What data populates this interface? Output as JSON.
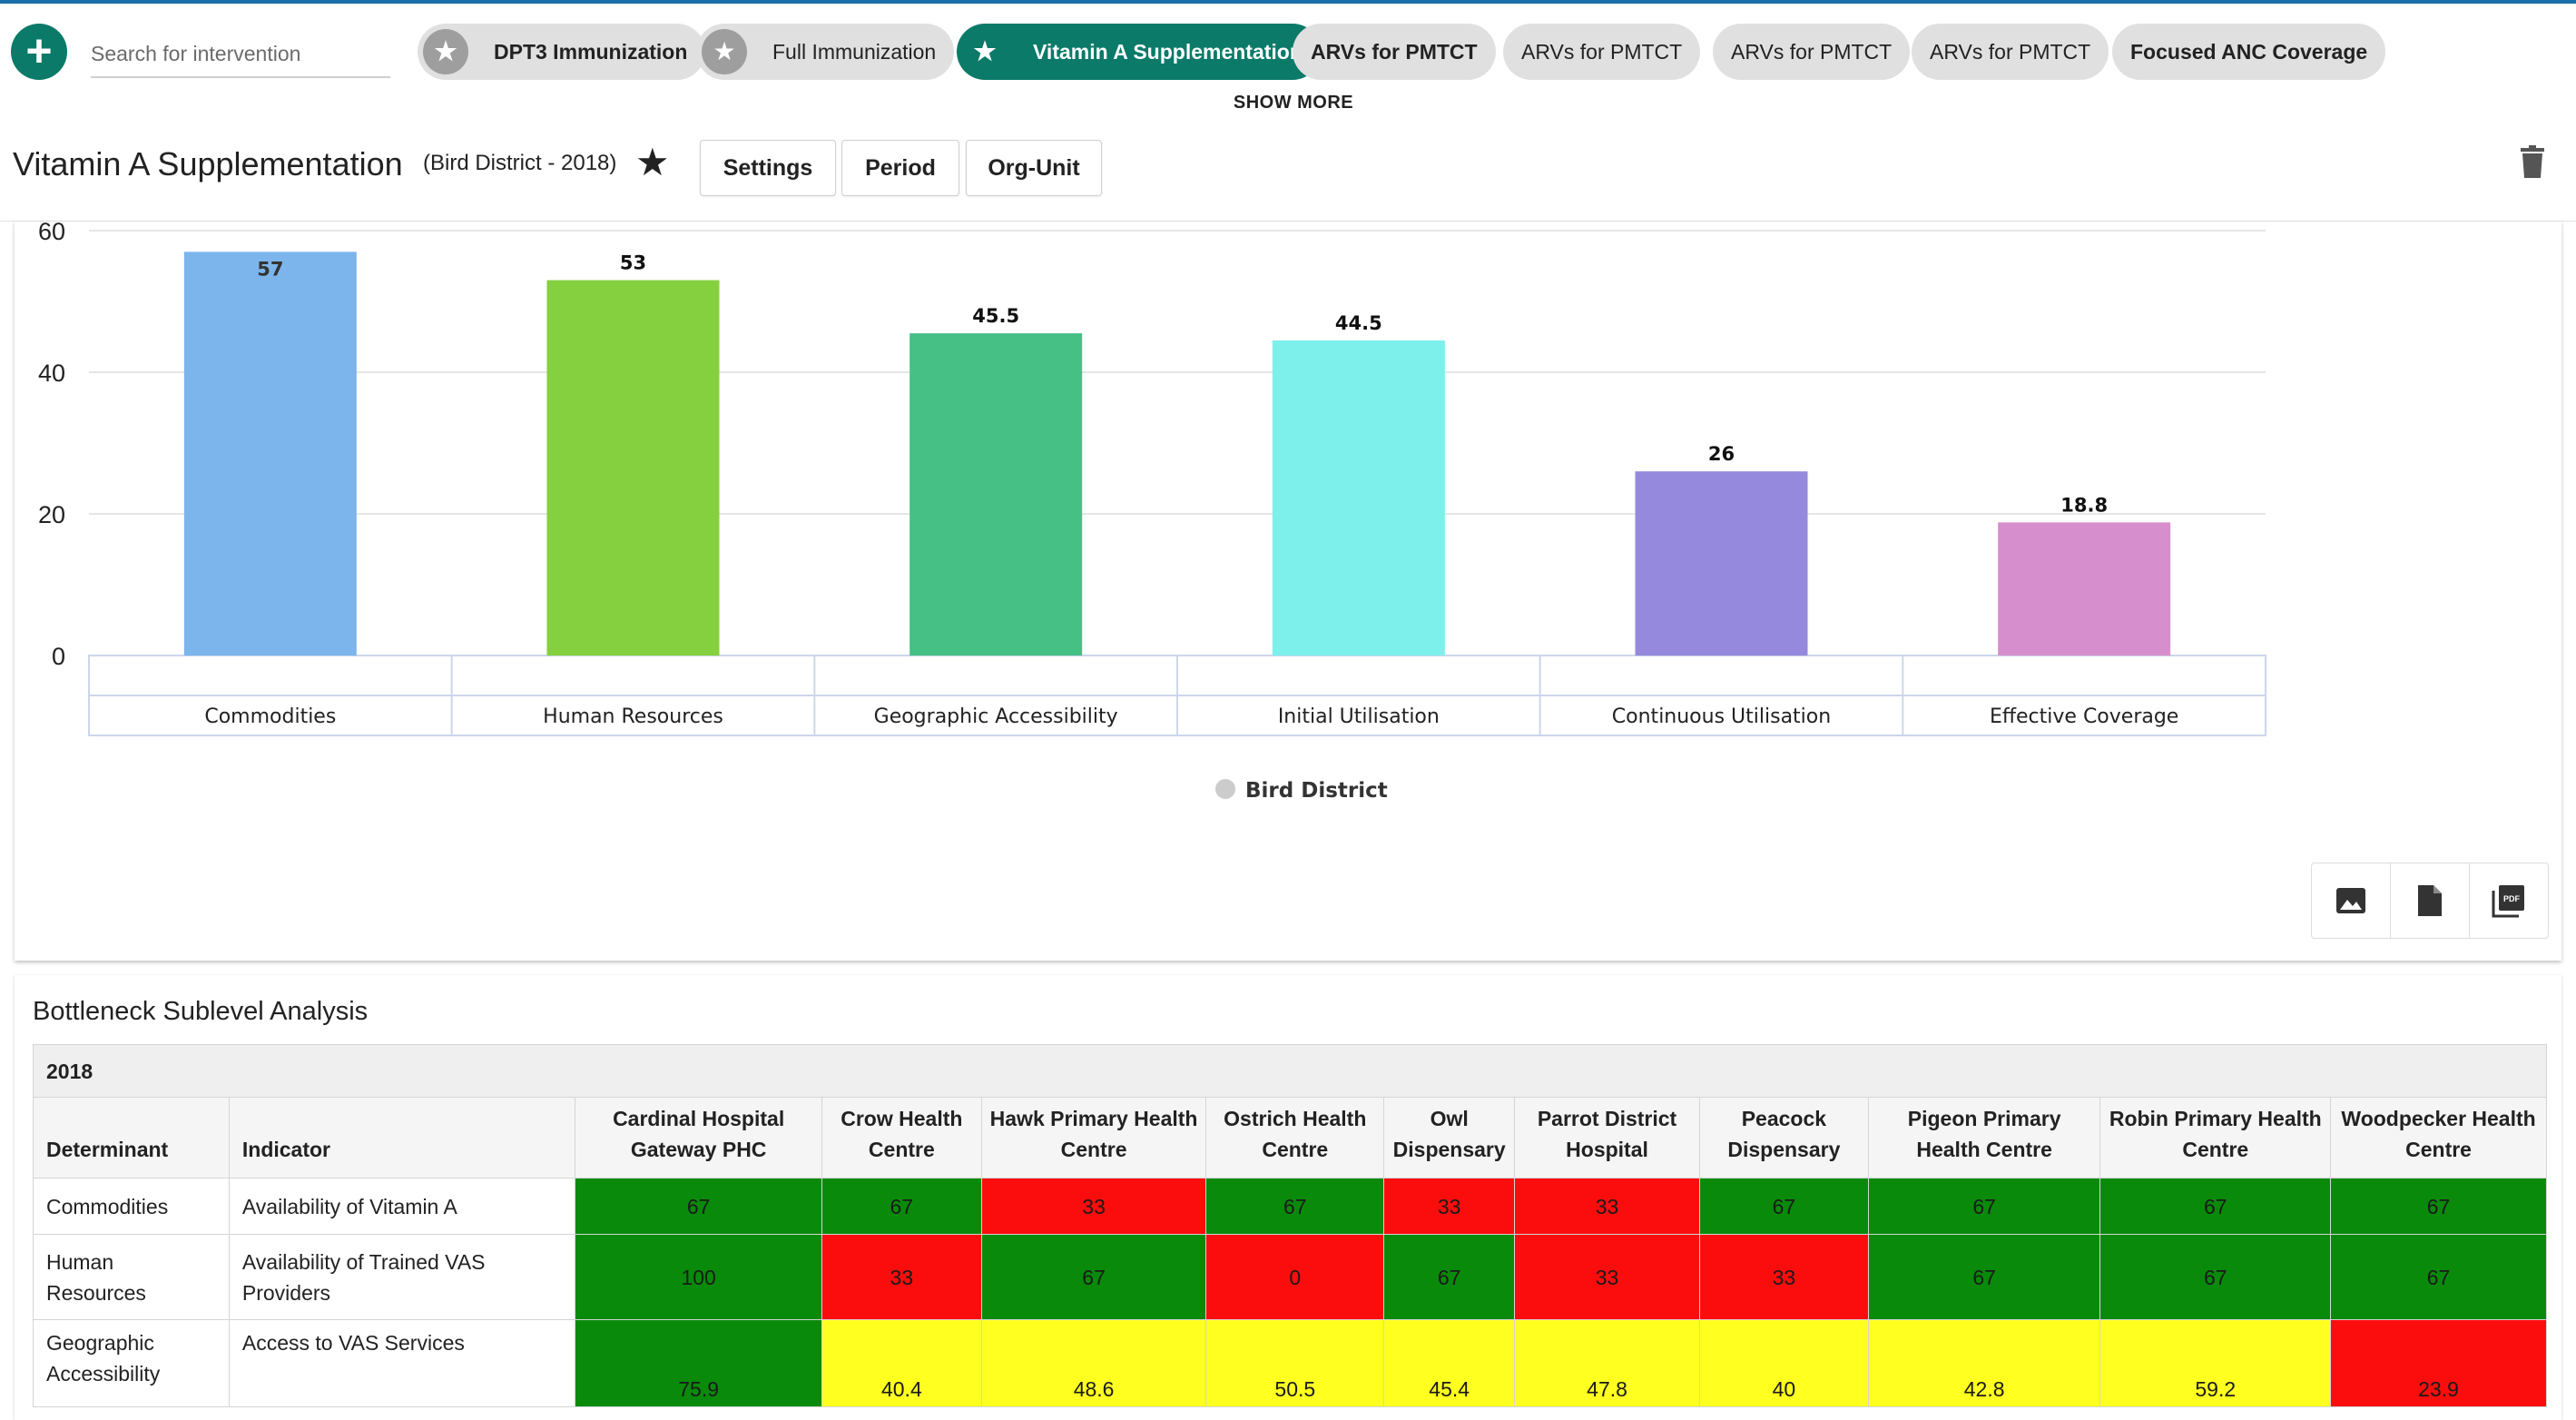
{
  "toolbar": {
    "search_placeholder": "Search for intervention",
    "chips": [
      {
        "label": "DPT3 Immunization",
        "star": true,
        "active": false,
        "bold": true
      },
      {
        "label": "Full Immunization",
        "star": true,
        "active": false,
        "bold": false
      },
      {
        "label": "Vitamin A Supplementation",
        "star": true,
        "active": true,
        "bold": true
      },
      {
        "label": "ARVs for PMTCT",
        "star": false,
        "active": false,
        "bold": true
      },
      {
        "label": "ARVs for PMTCT",
        "star": false,
        "active": false,
        "bold": false
      },
      {
        "label": "ARVs for PMTCT",
        "star": false,
        "active": false,
        "bold": false
      },
      {
        "label": "ARVs for PMTCT",
        "star": false,
        "active": false,
        "bold": false
      },
      {
        "label": "Focused ANC Coverage",
        "star": false,
        "active": false,
        "bold": true
      }
    ],
    "show_more": "SHOW MORE"
  },
  "header": {
    "title": "Vitamin A Supplementation",
    "subtitle": "(Bird District - 2018)",
    "buttons": [
      "Settings",
      "Period",
      "Org-Unit"
    ]
  },
  "colors": {
    "accent": "#0b7a69",
    "good": "#0a8a0a",
    "bad": "#fb0d0d",
    "warn": "#ffff20"
  },
  "chart_data": {
    "type": "bar",
    "categories": [
      "Commodities",
      "Human Resources",
      "Geographic Accessibility",
      "Initial Utilisation",
      "Continuous Utilisation",
      "Effective Coverage"
    ],
    "values": [
      57,
      53,
      45.5,
      44.5,
      26,
      18.8
    ],
    "colors": [
      "#7cb5ec",
      "#85d03f",
      "#46c085",
      "#7ef0ec",
      "#9489dc",
      "#d68fcc"
    ],
    "ylim": [
      0,
      60
    ],
    "yticks": [
      0,
      20,
      40,
      60
    ],
    "legend": [
      "Bird District"
    ],
    "legend_position": "bottom-center",
    "grid": true
  },
  "table": {
    "title": "Bottleneck Sublevel Analysis",
    "year": "2018",
    "col_determinant": "Determinant",
    "col_indicator": "Indicator",
    "columns": [
      "Cardinal Hospital Gateway PHC",
      "Crow Health Centre",
      "Hawk Primary Health Centre",
      "Ostrich Health Centre",
      "Owl Dispensary",
      "Parrot District Hospital",
      "Peacock Dispensary",
      "Pigeon Primary Health Centre",
      "Robin Primary Health Centre",
      "Woodpecker Health Centre"
    ],
    "rows": [
      {
        "determinant": "Commodities",
        "indicator": "Availability of Vitamin A",
        "values": [
          "67",
          "67",
          "33",
          "67",
          "33",
          "33",
          "67",
          "67",
          "67",
          "67"
        ],
        "status": [
          "good",
          "good",
          "bad",
          "good",
          "bad",
          "bad",
          "good",
          "good",
          "good",
          "good"
        ]
      },
      {
        "determinant": "Human Resources",
        "indicator": "Availability of Trained VAS Providers",
        "values": [
          "100",
          "33",
          "67",
          "0",
          "67",
          "33",
          "33",
          "67",
          "67",
          "67"
        ],
        "status": [
          "good",
          "bad",
          "good",
          "bad",
          "good",
          "bad",
          "bad",
          "good",
          "good",
          "good"
        ]
      },
      {
        "determinant": "Geographic Accessibility",
        "indicator": "Access to VAS Services",
        "values": [
          "75.9",
          "40.4",
          "48.6",
          "50.5",
          "45.4",
          "47.8",
          "40",
          "42.8",
          "59.2",
          "23.9"
        ],
        "status": [
          "good",
          "warn",
          "warn",
          "warn",
          "warn",
          "warn",
          "warn",
          "warn",
          "warn",
          "bad"
        ]
      }
    ]
  }
}
